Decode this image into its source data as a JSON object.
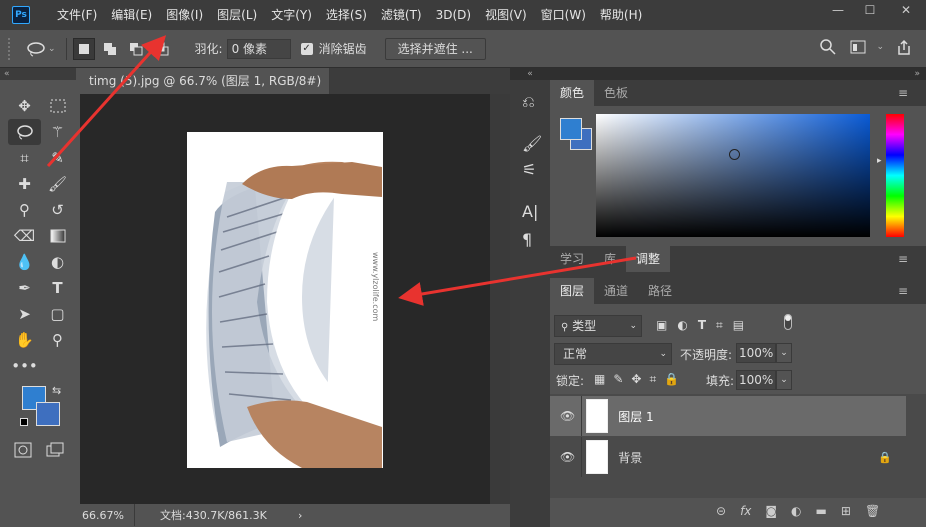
{
  "app": {
    "logo": "Ps"
  },
  "menu": [
    "文件(F)",
    "编辑(E)",
    "图像(I)",
    "图层(L)",
    "文字(Y)",
    "选择(S)",
    "滤镜(T)",
    "3D(D)",
    "视图(V)",
    "窗口(W)",
    "帮助(H)"
  ],
  "window_buttons": {
    "minimize": "—",
    "maximize": "☐",
    "close": "✕"
  },
  "options": {
    "feather_label": "羽化:",
    "feather_value": "0 像素",
    "antialias_label": "消除锯齿",
    "select_mask_label": "选择并遮住 ..."
  },
  "document": {
    "tab_title": "timg (5).jpg @ 66.7% (图层 1, RGB/8#) *",
    "tab_close": "×",
    "watermark": "www.ylzolife.com",
    "zoom": "66.67%",
    "doc_info": "文档:430.7K/861.3K",
    "status_arrow": "›"
  },
  "color_panel": {
    "tabs": [
      "颜色",
      "色板"
    ],
    "fg_color": "#2f7fd0",
    "bg_color": "#3e6fbf",
    "hue": "#0a5bd6"
  },
  "learn_panel": {
    "tabs": [
      "学习",
      "库",
      "调整"
    ]
  },
  "layers_panel": {
    "tabs": [
      "图层",
      "通道",
      "路径"
    ],
    "filter_kind": "类型",
    "blend_mode": "正常",
    "opacity_label": "不透明度:",
    "opacity_value": "100%",
    "lock_label": "锁定:",
    "fill_label": "填充:",
    "fill_value": "100%",
    "layers": [
      {
        "name": "图层 1",
        "selected": true,
        "locked": false
      },
      {
        "name": "背景",
        "selected": false,
        "locked": true
      }
    ]
  },
  "colors": {
    "annotation_arrow": "#e8332f"
  }
}
